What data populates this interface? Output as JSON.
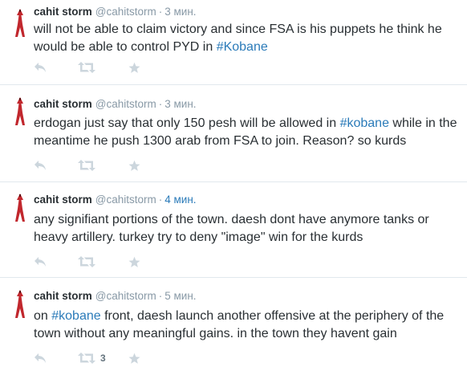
{
  "tweets": [
    {
      "name": "cahit storm",
      "handle": "@cahitstorm",
      "separator": "·",
      "time": "3 мин.",
      "time_highlight": false,
      "text_parts": [
        "will not be able to claim victory and since FSA is his puppets he think he would be able to control PYD in ",
        "#Kobane",
        ""
      ],
      "retweet_count": ""
    },
    {
      "name": "cahit storm",
      "handle": "@cahitstorm",
      "separator": "·",
      "time": "3 мин.",
      "time_highlight": false,
      "text_parts": [
        "erdogan just say that only 150 pesh will be allowed in ",
        "#kobane",
        " while in the meantime he push 1300 arab from FSA to join. Reason? so kurds"
      ],
      "retweet_count": ""
    },
    {
      "name": "cahit storm",
      "handle": "@cahitstorm",
      "separator": "·",
      "time": "4 мин.",
      "time_highlight": true,
      "text_parts": [
        "any signifiant portions of the town. daesh dont have anymore tanks or heavy artillery. turkey try to deny \"image\" win for the kurds",
        "",
        ""
      ],
      "retweet_count": ""
    },
    {
      "name": "cahit storm",
      "handle": "@cahitstorm",
      "separator": "·",
      "time": "5 мин.",
      "time_highlight": false,
      "text_parts": [
        "on ",
        "#kobane",
        " front, daesh launch another offensive at the periphery of the town without any meaningful gains. in the town they havent gain"
      ],
      "retweet_count": "3"
    }
  ],
  "icons": {
    "avatar": "red-figure-icon",
    "reply": "reply-icon",
    "retweet": "retweet-icon",
    "favorite": "star-icon"
  },
  "colors": {
    "link": "#2b7bb9",
    "muted": "#8899a6",
    "action_icon": "#ccd6dd",
    "avatar": "#c1272d",
    "divider": "#e1e8ed"
  }
}
